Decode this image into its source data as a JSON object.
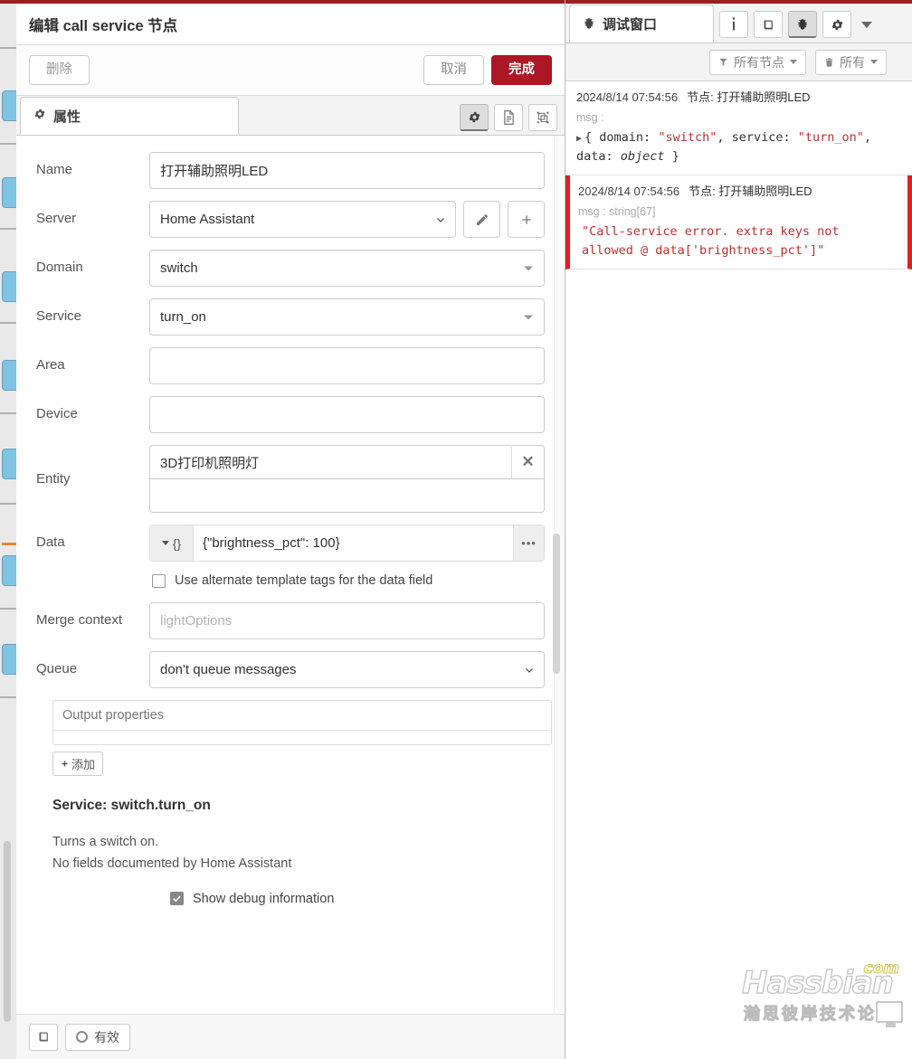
{
  "editor": {
    "title": "编辑 call service 节点",
    "actions": {
      "delete_label": "删除",
      "cancel_label": "取消",
      "done_label": "完成"
    },
    "tabs": {
      "properties_label": "属性",
      "gear_icon": "gear-icon",
      "description_icon": "document-icon",
      "appearance_icon": "appearance-icon"
    },
    "fields": {
      "name": {
        "label": "Name",
        "value": "打开辅助照明LED"
      },
      "server": {
        "label": "Server",
        "value": "Home Assistant",
        "edit_icon": "pencil-icon",
        "add_icon": "plus-icon"
      },
      "domain": {
        "label": "Domain",
        "value": "switch"
      },
      "service": {
        "label": "Service",
        "value": "turn_on"
      },
      "area": {
        "label": "Area",
        "value": ""
      },
      "device": {
        "label": "Device",
        "value": ""
      },
      "entity": {
        "label": "Entity",
        "value": "3D打印机照明灯",
        "clear_icon": "close-icon",
        "second_row_value": ""
      },
      "data": {
        "label": "Data",
        "type_token": "{}",
        "value": "{\"brightness_pct\": 100}",
        "more_icon": "ellipsis-icon"
      },
      "alt_template": {
        "label": "Use alternate template tags for the data field",
        "checked": false
      },
      "merge_context": {
        "label": "Merge context",
        "value": "",
        "placeholder": "lightOptions"
      },
      "queue": {
        "label": "Queue",
        "value": "don't queue messages"
      }
    },
    "output_properties": {
      "header": "Output properties",
      "add_label": "添加"
    },
    "service_info": {
      "title": "Service: switch.turn_on",
      "line1": "Turns a switch on.",
      "line2": "No fields documented by Home Assistant"
    },
    "show_debug": {
      "label": "Show debug information",
      "checked": true
    },
    "footer": {
      "book_icon": "book-icon",
      "enabled_label": "有效"
    }
  },
  "debug_panel": {
    "tab_label": "调试窗口",
    "tab_icon": "bug-icon",
    "toolbar_icons": [
      "info-icon",
      "book-icon",
      "bug-icon",
      "gear-icon",
      "chevron-down-icon"
    ],
    "filters": {
      "nodes_label": "所有节点",
      "nodes_icon": "filter-icon",
      "clear_label": "所有",
      "clear_icon": "trash-icon"
    },
    "messages": [
      {
        "timestamp": "2024/8/14 07:54:56",
        "node_prefix": "节点:",
        "node_name": "打开辅助照明LED",
        "key": "msg :",
        "is_error": false,
        "parts": [
          {
            "text": "{ domain: ",
            "cls": "k"
          },
          {
            "text": "\"switch\"",
            "cls": "s"
          },
          {
            "text": ", service: ",
            "cls": "k"
          },
          {
            "text": "\"turn_on\"",
            "cls": "s"
          },
          {
            "text": ", data: ",
            "cls": "k"
          },
          {
            "text": "object",
            "cls": "o"
          },
          {
            "text": " }",
            "cls": "k"
          }
        ]
      },
      {
        "timestamp": "2024/8/14 07:54:56",
        "node_prefix": "节点:",
        "node_name": "打开辅助照明LED",
        "key": "msg : string[67]",
        "is_error": true,
        "error_text": "\"Call-service error. extra keys not allowed @ data['brightness_pct']\""
      }
    ]
  },
  "watermark": {
    "main": "Hassbian",
    "tld": "com",
    "subtitle": "瀚思彼岸技术论坛"
  },
  "colors": {
    "accent_red": "#ad1625",
    "top_bar": "#9b2020",
    "error_red": "#e02020",
    "node_blue": "#80c4e4"
  }
}
